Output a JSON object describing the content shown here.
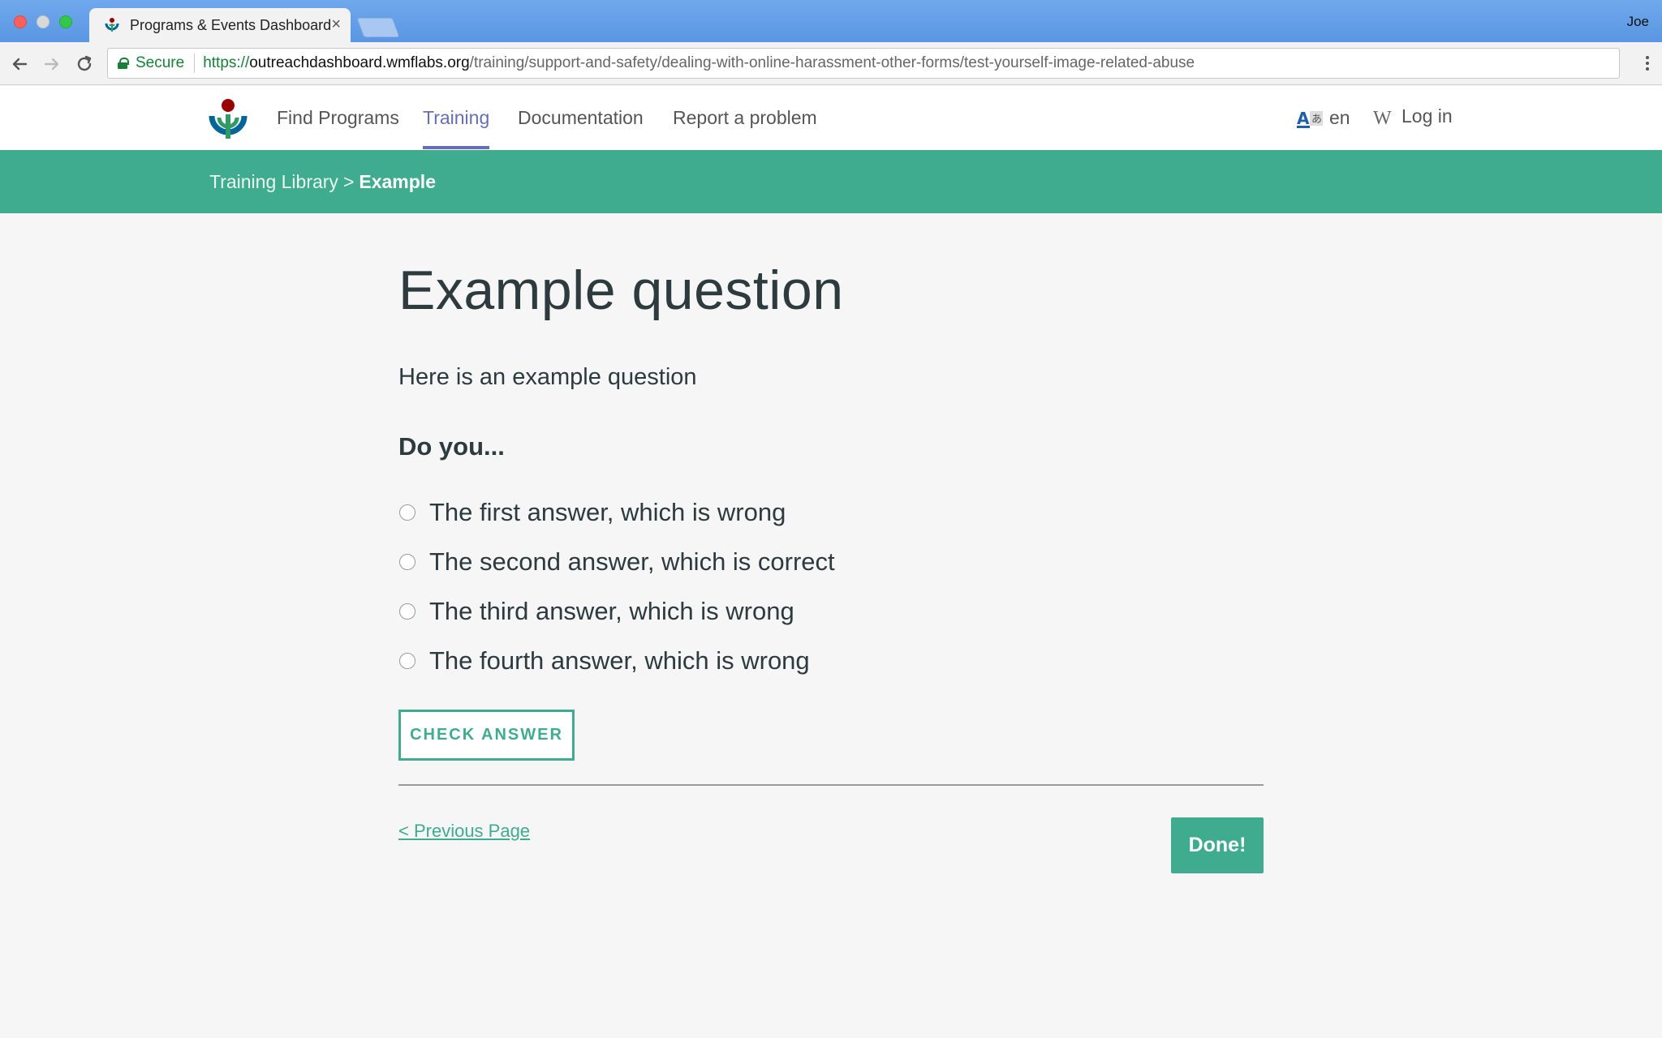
{
  "browser": {
    "tab_title": "Programs & Events Dashboard",
    "tab_close": "×",
    "profile_name": "Joe",
    "secure_label": "Secure",
    "url_scheme": "https://",
    "url_host": "outreachdashboard.wmflabs.org",
    "url_path": "/training/support-and-safety/dealing-with-online-harassment-other-forms/test-yourself-image-related-abuse"
  },
  "header": {
    "nav": [
      {
        "label": "Find Programs"
      },
      {
        "label": "Training"
      },
      {
        "label": "Documentation"
      },
      {
        "label": "Report a problem"
      }
    ],
    "active_nav": "Training",
    "language": "en",
    "login": "Log in",
    "wiki_glyph": "W",
    "active_color": "#676eb4"
  },
  "breadcrumb": {
    "parent": "Training Library",
    "separator": ">",
    "current": "Example"
  },
  "content": {
    "title": "Example question",
    "question": "Here is an example question",
    "prompt": "Do you...",
    "answers": [
      {
        "label": "The first answer, which is wrong"
      },
      {
        "label": "The second answer, which is correct"
      },
      {
        "label": "The third answer, which is wrong"
      },
      {
        "label": "The fourth answer, which is wrong"
      }
    ],
    "check_button": "CHECK ANSWER",
    "previous_link": "< Previous Page",
    "done_button": "Done!"
  },
  "colors": {
    "brand_green": "#3fab8f",
    "text_dark": "#2d3a3e"
  },
  "icons": {
    "tab_favicon": "wikimedia-logo-icon",
    "lock": "lock-icon",
    "back": "arrow-left-icon",
    "forward": "arrow-right-icon",
    "reload": "reload-icon",
    "menu": "kebab-menu-icon",
    "language": "language-icon",
    "wikipedia": "wikipedia-w-icon"
  }
}
